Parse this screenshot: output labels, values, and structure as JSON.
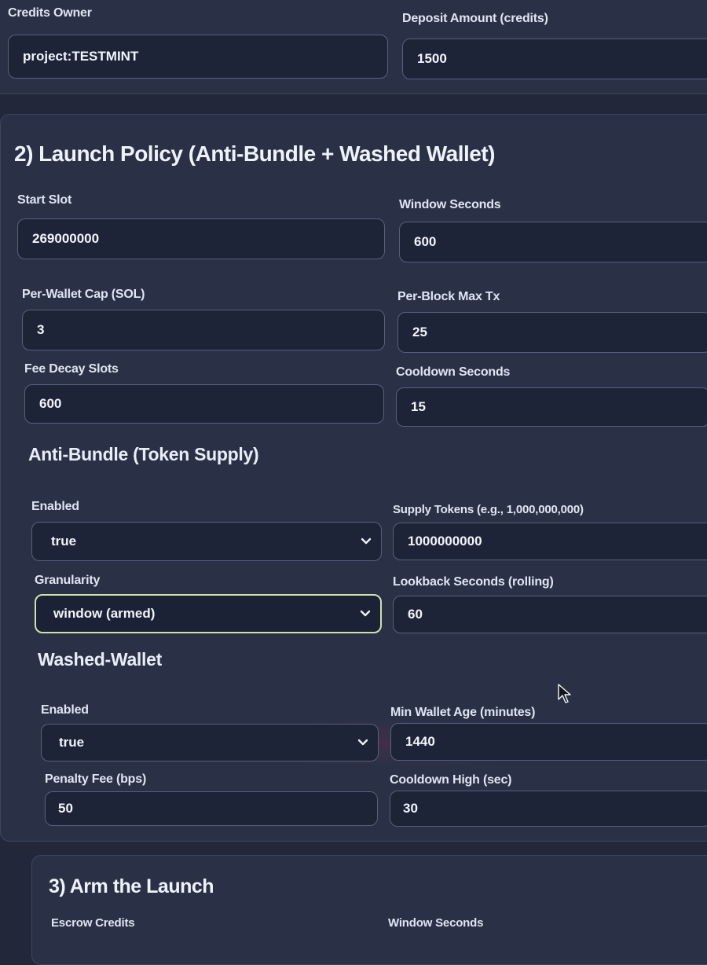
{
  "credits": {
    "owner_label": "Credits Owner",
    "owner_value": "project:TESTMINT",
    "deposit_label": "Deposit Amount (credits)",
    "deposit_value": "1500"
  },
  "launch_policy": {
    "title": "2) Launch Policy (Anti-Bundle + Washed Wallet)",
    "start_slot_label": "Start Slot",
    "start_slot_value": "269000000",
    "window_seconds_label": "Window Seconds",
    "window_seconds_value": "600",
    "per_wallet_cap_label": "Per-Wallet Cap (SOL)",
    "per_wallet_cap_value": "3",
    "per_block_max_label": "Per-Block Max Tx",
    "per_block_max_value": "25",
    "fee_decay_label": "Fee Decay Slots",
    "fee_decay_value": "600",
    "cooldown_label": "Cooldown Seconds",
    "cooldown_value": "15"
  },
  "anti_bundle": {
    "title": "Anti-Bundle (Token Supply)",
    "enabled_label": "Enabled",
    "enabled_value": "true",
    "supply_label": "Supply Tokens (e.g., 1,000,000,000)",
    "supply_value": "1000000000",
    "granularity_label": "Granularity",
    "granularity_value": "window (armed)",
    "lookback_label": "Lookback Seconds (rolling)",
    "lookback_value": "60"
  },
  "washed_wallet": {
    "title": "Washed-Wallet",
    "enabled_label": "Enabled",
    "enabled_value": "true",
    "min_age_label": "Min Wallet Age (minutes)",
    "min_age_value": "1440",
    "penalty_label": "Penalty Fee (bps)",
    "penalty_value": "50",
    "cooldown_high_label": "Cooldown High (sec)",
    "cooldown_high_value": "30"
  },
  "arm": {
    "title": "3) Arm the Launch",
    "escrow_label": "Escrow Credits",
    "window_seconds_label": "Window Seconds"
  },
  "icons": {
    "select_chevron": "chevron-down-icon",
    "cursor": "mouse-pointer-icon"
  },
  "colors": {
    "background": "#22283a",
    "panel": "#2a3147",
    "input": "#1e2438",
    "armed_border": "#cfe0b0"
  }
}
